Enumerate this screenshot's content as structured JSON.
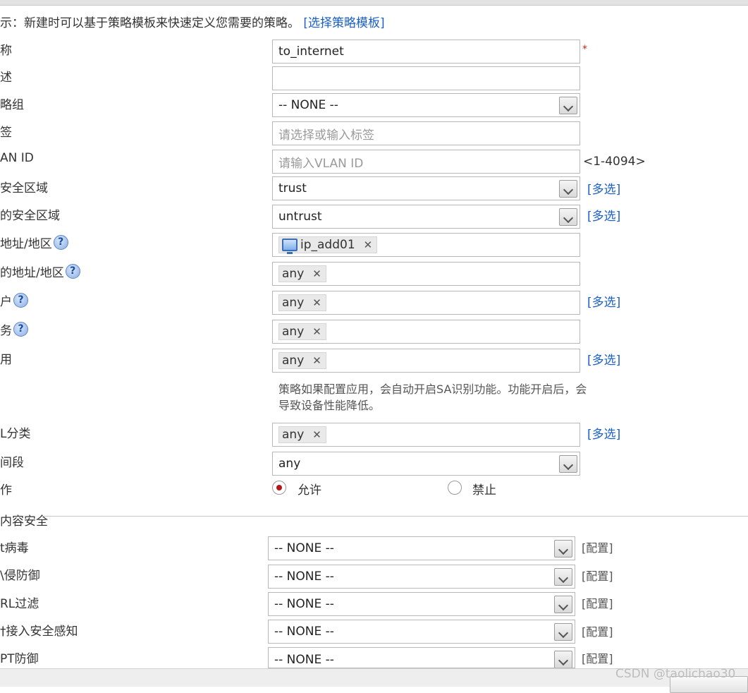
{
  "hint": {
    "text": "示：新建时可以基于策略模板来快速定义您需要的策略。",
    "template_link": "[选择策略模板]"
  },
  "form": {
    "name": {
      "label": "称",
      "value": "to_internet",
      "required_mark": "*"
    },
    "description": {
      "label": "述",
      "value": ""
    },
    "policy_group": {
      "label": "略组",
      "value": "-- NONE --"
    },
    "tag": {
      "label": "签",
      "placeholder": "请选择或输入标签"
    },
    "vlan": {
      "label": "AN ID",
      "placeholder": "请输入VLAN ID",
      "range": "<1-4094>"
    },
    "src_zone": {
      "label": "安全区域",
      "value": "trust",
      "multi_link": "[多选]"
    },
    "dst_zone": {
      "label": "的安全区域",
      "value": "untrust",
      "multi_link": "[多选]"
    },
    "src_addr": {
      "label": "地址/地区",
      "tag": "ip_add01"
    },
    "dst_addr": {
      "label": "的地址/地区",
      "tag": "any"
    },
    "user": {
      "label": "户",
      "tag": "any",
      "multi_link": "[多选]"
    },
    "service": {
      "label": "务",
      "tag": "any"
    },
    "application": {
      "label": "用",
      "tag": "any",
      "multi_link": "[多选]",
      "note": "策略如果配置应用，会自动开启SA识别功能。功能开启后，会导致设备性能降低。"
    },
    "url_category": {
      "label": "L分类",
      "tag": "any",
      "multi_link": "[多选]"
    },
    "time_range": {
      "label": "间段",
      "value": "any"
    },
    "action": {
      "label": "作",
      "allow": "允许",
      "deny": "禁止",
      "selected": "allow"
    }
  },
  "content_security": {
    "section_title": "内容安全",
    "config_link": "[配置]",
    "rows": [
      {
        "label": "t病毒",
        "value": "-- NONE --"
      },
      {
        "label": "\\侵防御",
        "value": "-- NONE --"
      },
      {
        "label": "RL过滤",
        "value": "-- NONE --"
      },
      {
        "label": "†接入安全感知",
        "value": "-- NONE --"
      },
      {
        "label": "PT防御",
        "value": "-- NONE --"
      }
    ]
  },
  "watermark": "CSDN @taolichao30",
  "help_icon_glyph": "?",
  "remove_glyph": "✕"
}
